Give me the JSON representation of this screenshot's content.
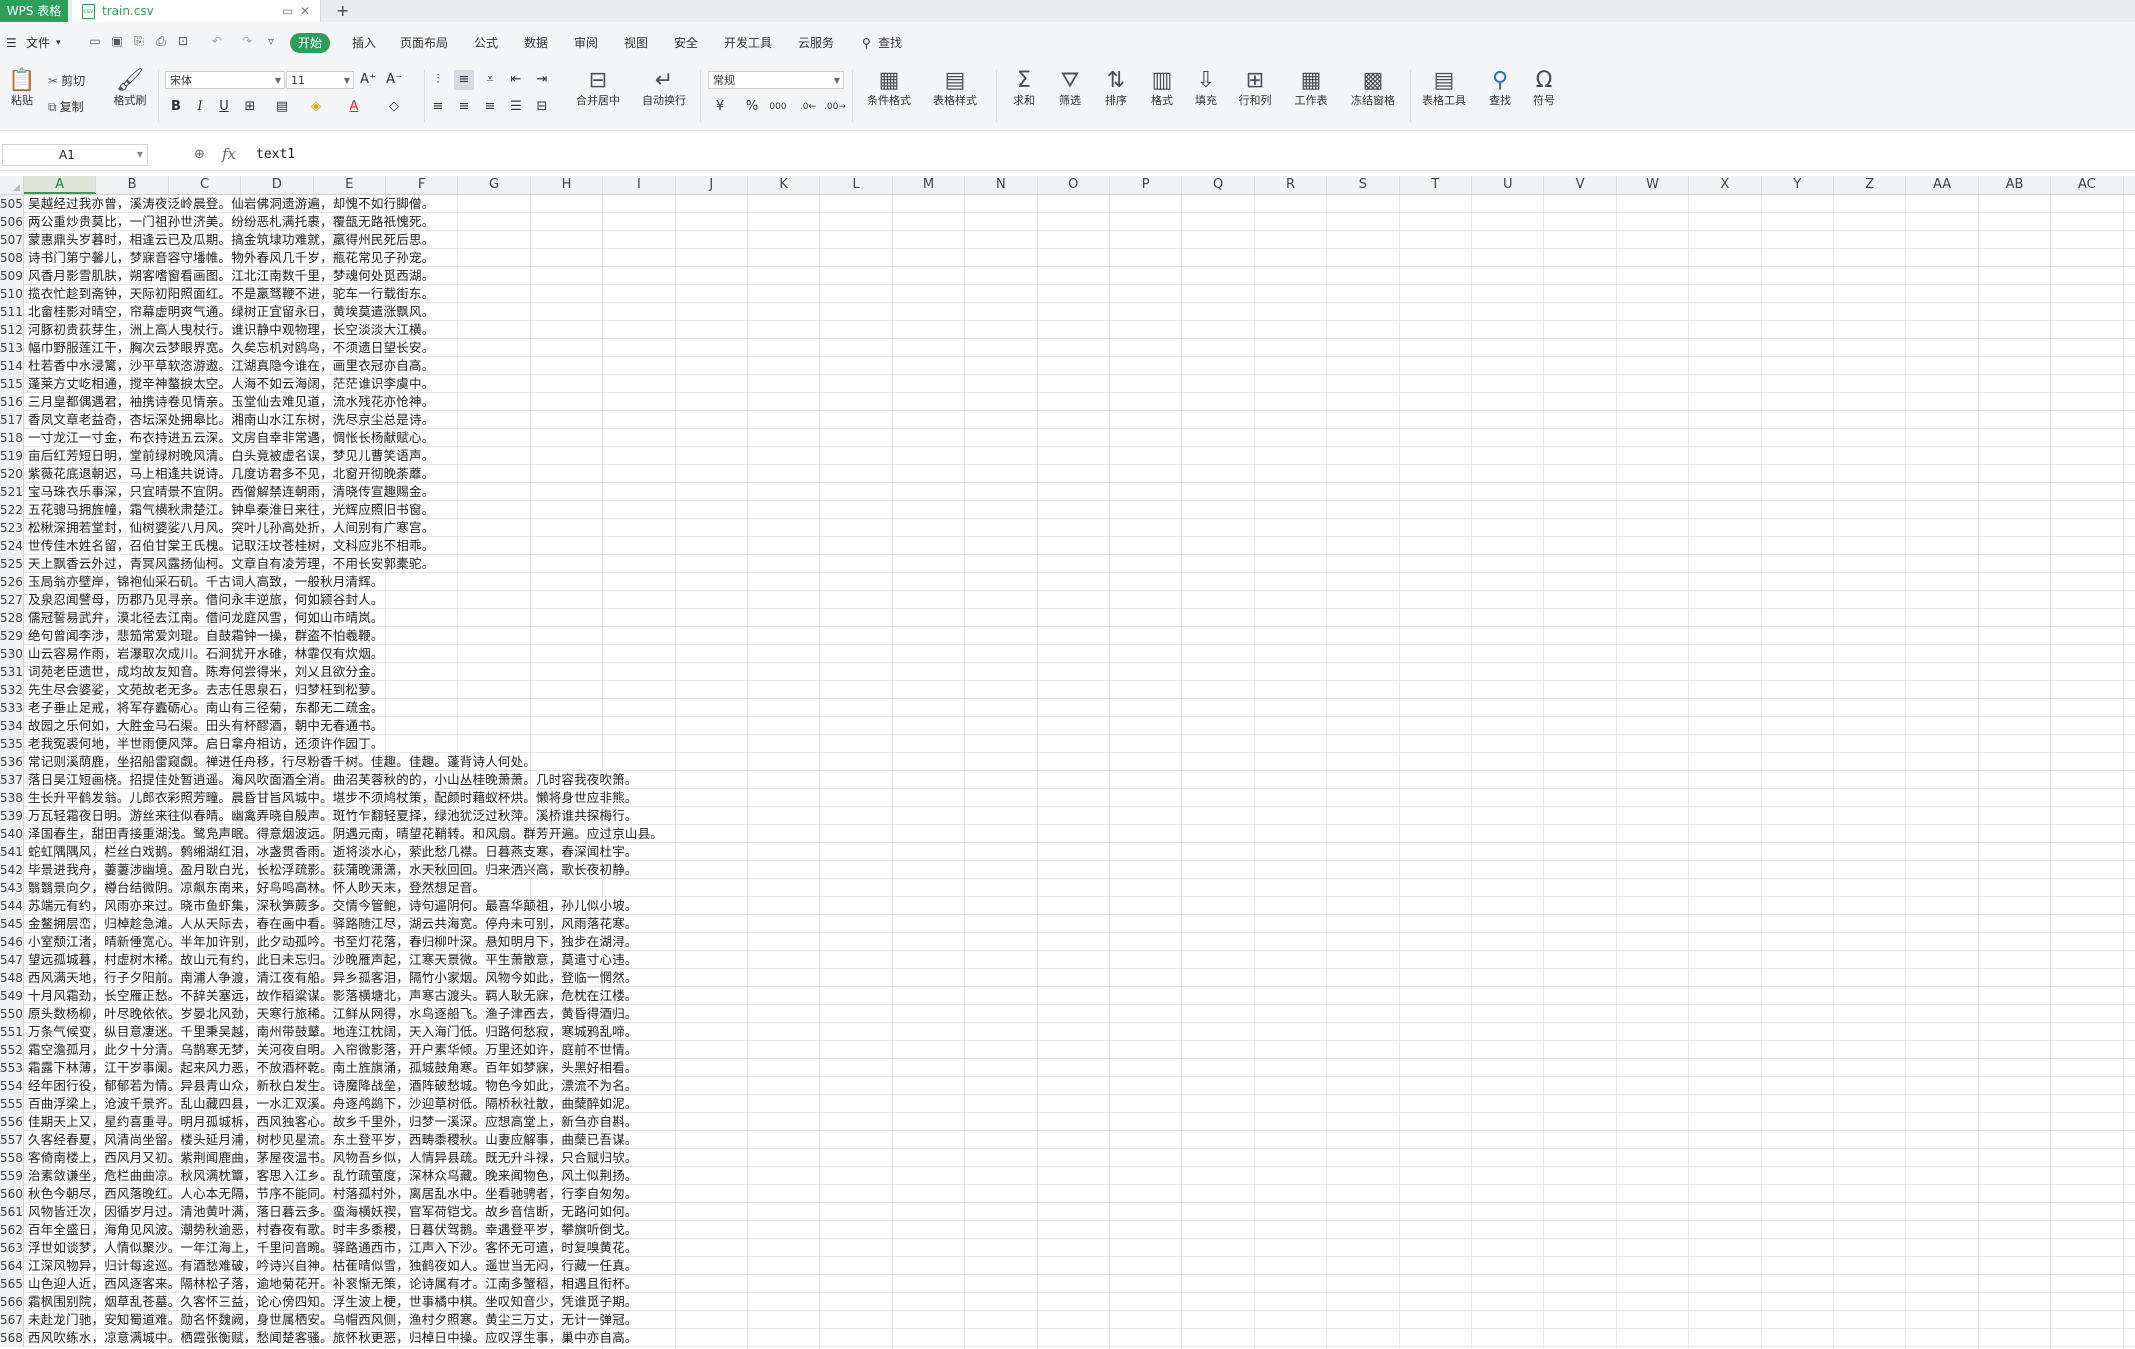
{
  "tabs": {
    "app_tab": "WPS 表格",
    "file_tab": "train.csv",
    "new_tab": "+"
  },
  "menu": {
    "file": "文件",
    "items": [
      "开始",
      "插入",
      "页面布局",
      "公式",
      "数据",
      "审阅",
      "视图",
      "安全",
      "开发工具",
      "云服务"
    ],
    "search": "查找"
  },
  "ribbon": {
    "paste": "粘贴",
    "cut": "剪切",
    "copy": "复制",
    "format_painter": "格式刷",
    "font_name": "宋体",
    "font_size": "11",
    "number_format": "常规",
    "merge_center": "合并居中",
    "wrap_text": "自动换行",
    "conditional_format": "条件格式",
    "table_style": "表格样式",
    "sum": "求和",
    "filter": "筛选",
    "sort": "排序",
    "format": "格式",
    "fill": "填充",
    "row_col": "行和列",
    "worksheet": "工作表",
    "freeze": "冻结窗格",
    "table_tools": "表格工具",
    "find": "查找",
    "symbol": "符号"
  },
  "formula_bar": {
    "cell_ref": "A1",
    "fx": "fx",
    "value": "text1"
  },
  "columns": [
    "A",
    "B",
    "C",
    "D",
    "E",
    "F",
    "G",
    "H",
    "I",
    "J",
    "K",
    "L",
    "M",
    "N",
    "O",
    "P",
    "Q",
    "R",
    "S",
    "T",
    "U",
    "V",
    "W",
    "X",
    "Y",
    "Z",
    "AA",
    "AB",
    "AC"
  ],
  "rows": [
    {
      "n": "505",
      "t": "吴越经过我亦曾，溪涛夜泛岭晨登。仙岩佛洞遗游遍，却愧不如行脚僧。"
    },
    {
      "n": "506",
      "t": "两公重炒贵莫比，一门祖孙世济美。纷纷恶札满托裹，覆瓿无路祇愧死。"
    },
    {
      "n": "507",
      "t": "蒙惠鼎头岁暮时，相逢云已及瓜期。搞金筑埭功难就，羸得州民死后思。"
    },
    {
      "n": "508",
      "t": "诗书门第宁馨儿，梦寐音容守墦帷。物外春风几千岁，瓶花常见子孙宠。"
    },
    {
      "n": "509",
      "t": "风香月影雪肌肤，朔客嗜窗看画图。江北江南数千里，梦魂何处觅西湖。"
    },
    {
      "n": "510",
      "t": "揽衣忙趁到斋钟，天际初阳照面红。不是羸驽鞭不进，驼车一行载街东。"
    },
    {
      "n": "511",
      "t": "北畲桂影对晴空，帘幕虚明爽气通。绿树正宜留永日，黄埃莫遣涨飘风。"
    },
    {
      "n": "512",
      "t": "河豚初贵荻芽生，洲上高人曳杖行。谁识静中观物理，长空淡淡大江横。"
    },
    {
      "n": "513",
      "t": "幅巾野服莲江干，胸次云梦眼界宽。久矣忘机对鸥鸟，不须遗日望长安。"
    },
    {
      "n": "514",
      "t": "杜若香中水浸篱，沙平草软恣游遨。江湖真隐今谁在，画里衣冠亦自高。"
    },
    {
      "n": "515",
      "t": "蓬莱方丈屹相通，搅辛神螯捩太空。人海不如云海阔，茫茫谁识李虞中。"
    },
    {
      "n": "516",
      "t": "三月皇都偶遇君，袖携诗卷见情亲。玉堂仙去难见道，流水残花亦怆神。"
    },
    {
      "n": "517",
      "t": "香凤文章老益奇，杏坛深处拥皋比。湘南山水江东树，洗尽京尘总是诗。"
    },
    {
      "n": "518",
      "t": "一寸龙江一寸金，布衣持进五云深。文房自幸非常遇，惆怅长杨献赋心。"
    },
    {
      "n": "519",
      "t": "亩后红芳短日明，堂前绿树晚风清。白头竟被虚名误，梦见儿曹笑语声。"
    },
    {
      "n": "520",
      "t": "紫薇花底退朝迟，马上相逢共说诗。几度访君多不见，北窗开彻晚荼蘼。"
    },
    {
      "n": "521",
      "t": "宝马珠衣乐事深，只宜晴景不宜阴。西僧解禁连朝雨，清晓传宣趣赐金。"
    },
    {
      "n": "522",
      "t": "五花骢马拥旌幢，霜气横秋肃楚江。钟阜秦淮日来往，光辉应照旧书窗。"
    },
    {
      "n": "523",
      "t": "松楸深拥若堂封，仙树婆娑八月风。突叶儿孙高处折，人间别有广寒宫。"
    },
    {
      "n": "524",
      "t": "世传佳木姓名留，召伯甘棠王氏槐。记取汪坟苍桂树，文科应兆不相乖。"
    },
    {
      "n": "525",
      "t": "天上飘香云外过，青冥风露扬仙柯。文章自有凌芳理，不用长安郭橐驼。"
    },
    {
      "n": "526",
      "t": "玉局翁亦壁岸，锦袍仙采石矶。千古词人高致，一般秋月清辉。"
    },
    {
      "n": "527",
      "t": "及泉忍闻譬母，历郡乃见寻亲。借问永丰逆旅，何如颍谷封人。"
    },
    {
      "n": "528",
      "t": "儒冠誓易武弁，漠北径去江南。借问龙庭风雪，何如山市晴岚。"
    },
    {
      "n": "529",
      "t": "绝句曾闻李涉，悲笳常爱刘琨。自鼓霜钟一操，群盗不怕羲鞭。"
    },
    {
      "n": "530",
      "t": "山云容易作雨，岩瀑取次成川。石涧犹开水碓，林霏仅有炊烟。"
    },
    {
      "n": "531",
      "t": "词苑老臣遗世，成均故友知音。陈寿何尝得米，刘乂且欲分金。"
    },
    {
      "n": "532",
      "t": "先生尽会婆娑，文苑故老无多。去志任思泉石，归梦枉到松萝。"
    },
    {
      "n": "533",
      "t": "老子垂止足戒，将军存蠹砺心。南山有三径菊，东都无二疏金。"
    },
    {
      "n": "534",
      "t": "故园之乐何如，大胜金马石渠。田头有杯醪酒，朝中无春通书。"
    },
    {
      "n": "535",
      "t": "老我冤裘何地，半世雨便风萍。启日拿舟相访，还须许作园丁。"
    },
    {
      "n": "536",
      "t": "常记则溪荫鹿，坐招船雷窥觑。禅进任舟移，行尽粉香千树。佳趣。佳趣。蓬背诗人何处。"
    },
    {
      "n": "537",
      "t": "落日吴江短画桡。招提佳处暂逍遥。海风吹面酒全消。曲沼芙蓉秋的的，小山丛桂晚萧萧。几时容我夜吹箫。"
    },
    {
      "n": "538",
      "t": "生长升平鹤发翁。儿郎衣彩照芳疃。晨昏甘旨风城中。堪步不须鸠杖策，配颜时藉蚁杯烘。懒将身世应非熊。"
    },
    {
      "n": "539",
      "t": "万瓦轻霜夜日明。游丝来往似春晴。幽禽弄晓自殷声。斑竹乍翻轻夏择，绿池犹泛过秋萍。溪桥谁共探梅行。"
    },
    {
      "n": "540",
      "t": "泽国春生，甜田青接重湖浅。鹭凫声眠。得意烟波远。阴遇元南，晴望花鞘转。和风扇。群芳开遍。应过京山县。"
    },
    {
      "n": "541",
      "t": "蛇虹隅隅风，栏丝白戏鹅。鹩缃湖红泪，冰盏贯香雨。逝将淡水心，萦此愁几襟。日暮燕支寒，春深闻杜宇。"
    },
    {
      "n": "542",
      "t": "毕景进我舟，萋萋涉幽境。盈月耿白光，长松浮疏影。荻蒲晚潇潇，水天秋回回。归来洒兴高，歌长夜初静。"
    },
    {
      "n": "543",
      "t": "翳翳景向夕，樽台结微阴。凉飙东南来，好鸟鸣高林。怀人眇天末，登然想足音。"
    },
    {
      "n": "544",
      "t": "苏端元有约，风雨亦来过。晓市鱼虾集，深秋笋蕨多。交情今管鲍，诗句逼阴何。最喜华颠祖，孙儿似小坡。"
    },
    {
      "n": "545",
      "t": "金鳌拥层峦，归棹趁急滩。人从天际去，春在画中看。驿路随江尽，湖云共海宽。停舟未可别，风雨落花寒。"
    },
    {
      "n": "546",
      "t": "小室颓江渚，晴新倕宽心。半年加许别，此夕动孤吟。书至灯花落，春归柳叶深。悬知明月下，独步在湖浔。"
    },
    {
      "n": "547",
      "t": "望远孤城暮，村虚树木稀。故山元有约，此日未忘归。沙晚雁声起，江寒天景微。平生萧散意，莫遣寸心违。"
    },
    {
      "n": "548",
      "t": "西风满天地，行子夕阳前。南浦人争渡，清江夜有船。异乡孤客泪，隔竹小家烟。风物今如此，登临一惘然。"
    },
    {
      "n": "549",
      "t": "十月风霜劲，长空雁正愁。不辞关塞远，故作稻粱谋。影落横塘北，声寒古渡头。羁人耿无寐，危枕在江楼。"
    },
    {
      "n": "550",
      "t": "原头数杨柳，叶尽晚依依。岁晏北风劲，天寒行旅稀。江鲜从网得，水鸟逐船飞。渔子津西去，黄昏得酒归。"
    },
    {
      "n": "551",
      "t": "万条气候变，纵目意凄迷。千里秉吴越，南州带鼓鼙。地连江枕阔，天入海门低。归路何愁寂，寒城鸦乱啼。"
    },
    {
      "n": "552",
      "t": "霜空澹孤月，此夕十分清。乌鹊寒无梦，关河夜自明。入帘微影落，开户素华倾。万里还如许，庭前不世情。"
    },
    {
      "n": "553",
      "t": "霜露下林薄，江干岁事阑。起来风力恶，不放酒杯乾。南土旌旗涌，孤城鼓角寒。百年如梦寐，头黑好相看。"
    },
    {
      "n": "554",
      "t": "经年困行役，郁郁若为情。异县青山众，新秋白发生。诗魔降战垒，酒阵破愁城。物色今如此，漂流不为名。"
    },
    {
      "n": "555",
      "t": "百曲浮梁上，沧波千景齐。乱山藏四县，一水汇双溪。舟逐鸬鹚下，沙迎草树低。隔桥秋社散，曲蘖醉如泥。"
    },
    {
      "n": "556",
      "t": "佳期天上又，星约喜重寻。明月孤城柝，西风独客心。故乡千里外，归梦一溪深。应想高堂上，新刍亦自斟。"
    },
    {
      "n": "557",
      "t": "久客经春夏，风清尚坐留。楼头延月浦，树杪见星流。东土登平岁，西畴黍稷秋。山妻应解事，曲蘖已吾谋。"
    },
    {
      "n": "558",
      "t": "客倚南楼上，西风月又初。紫荆闻鹿曲，茅屋夜温书。风物吾乡似，人情异县疏。既无升斗禄，只合赋归欤。"
    },
    {
      "n": "559",
      "t": "治素敛谦坐，危栏曲曲凉。秋风满枕簟，客思入江乡。乱竹疏萤度，深林众鸟藏。晚来闻物色，风土似荆扬。"
    },
    {
      "n": "560",
      "t": "秋色今朝尽，西风落晚红。人心本无隔，节序不能同。村落孤村外，离居乱水中。坐看驰骋者，行李自匆匆。"
    },
    {
      "n": "561",
      "t": "风物皆迁次，因循岁月过。清池黄叶满，落日暮云多。蛮海横妖禊，官军荷铠戈。故乡音信断，无路问如何。"
    },
    {
      "n": "562",
      "t": "百年全盛日，海角见风波。潮势秋逾恶，村舂夜有歌。时丰多黍稷，日暮伏驾鹅。幸遇登平岁，攀旗听倒戈。"
    },
    {
      "n": "563",
      "t": "浮世如谈梦，人情似聚沙。一年江海上，千里问音畹。驿路通西市，江声入下沙。客怀无可遣，时复嗅黄花。"
    },
    {
      "n": "564",
      "t": "江深风物异，归计每逡巡。有酒愁难破，吟诗兴自神。枯萑晴似雪，独鹤夜如人。遥世当无闷，行藏一任真。"
    },
    {
      "n": "565",
      "t": "山色迎人近，西风逐客来。隔林松子落，逾地菊花开。补衮惭无策，论诗属有才。江南多蟹稻，相遇且衔杯。"
    },
    {
      "n": "566",
      "t": "霜枫围别院，烟草乱苍墓。久客怀三益，论心傍四知。浮生波上梗，世事橘中棋。坐叹知音少，凭谁觅子期。"
    },
    {
      "n": "567",
      "t": "未赴龙门驰，安知蜀道难。勋名怀魏阙，身世属栖安。乌帽西风侧，渔村夕照寒。黄尘三万丈，无计一弹冠。"
    },
    {
      "n": "568",
      "t": "西风吹练水，凉意满城中。栖霞张衡赋，愁闻楚客骚。旅怀秋更恶，归棹日中操。应叹浮生事，巢中亦自高。"
    }
  ]
}
